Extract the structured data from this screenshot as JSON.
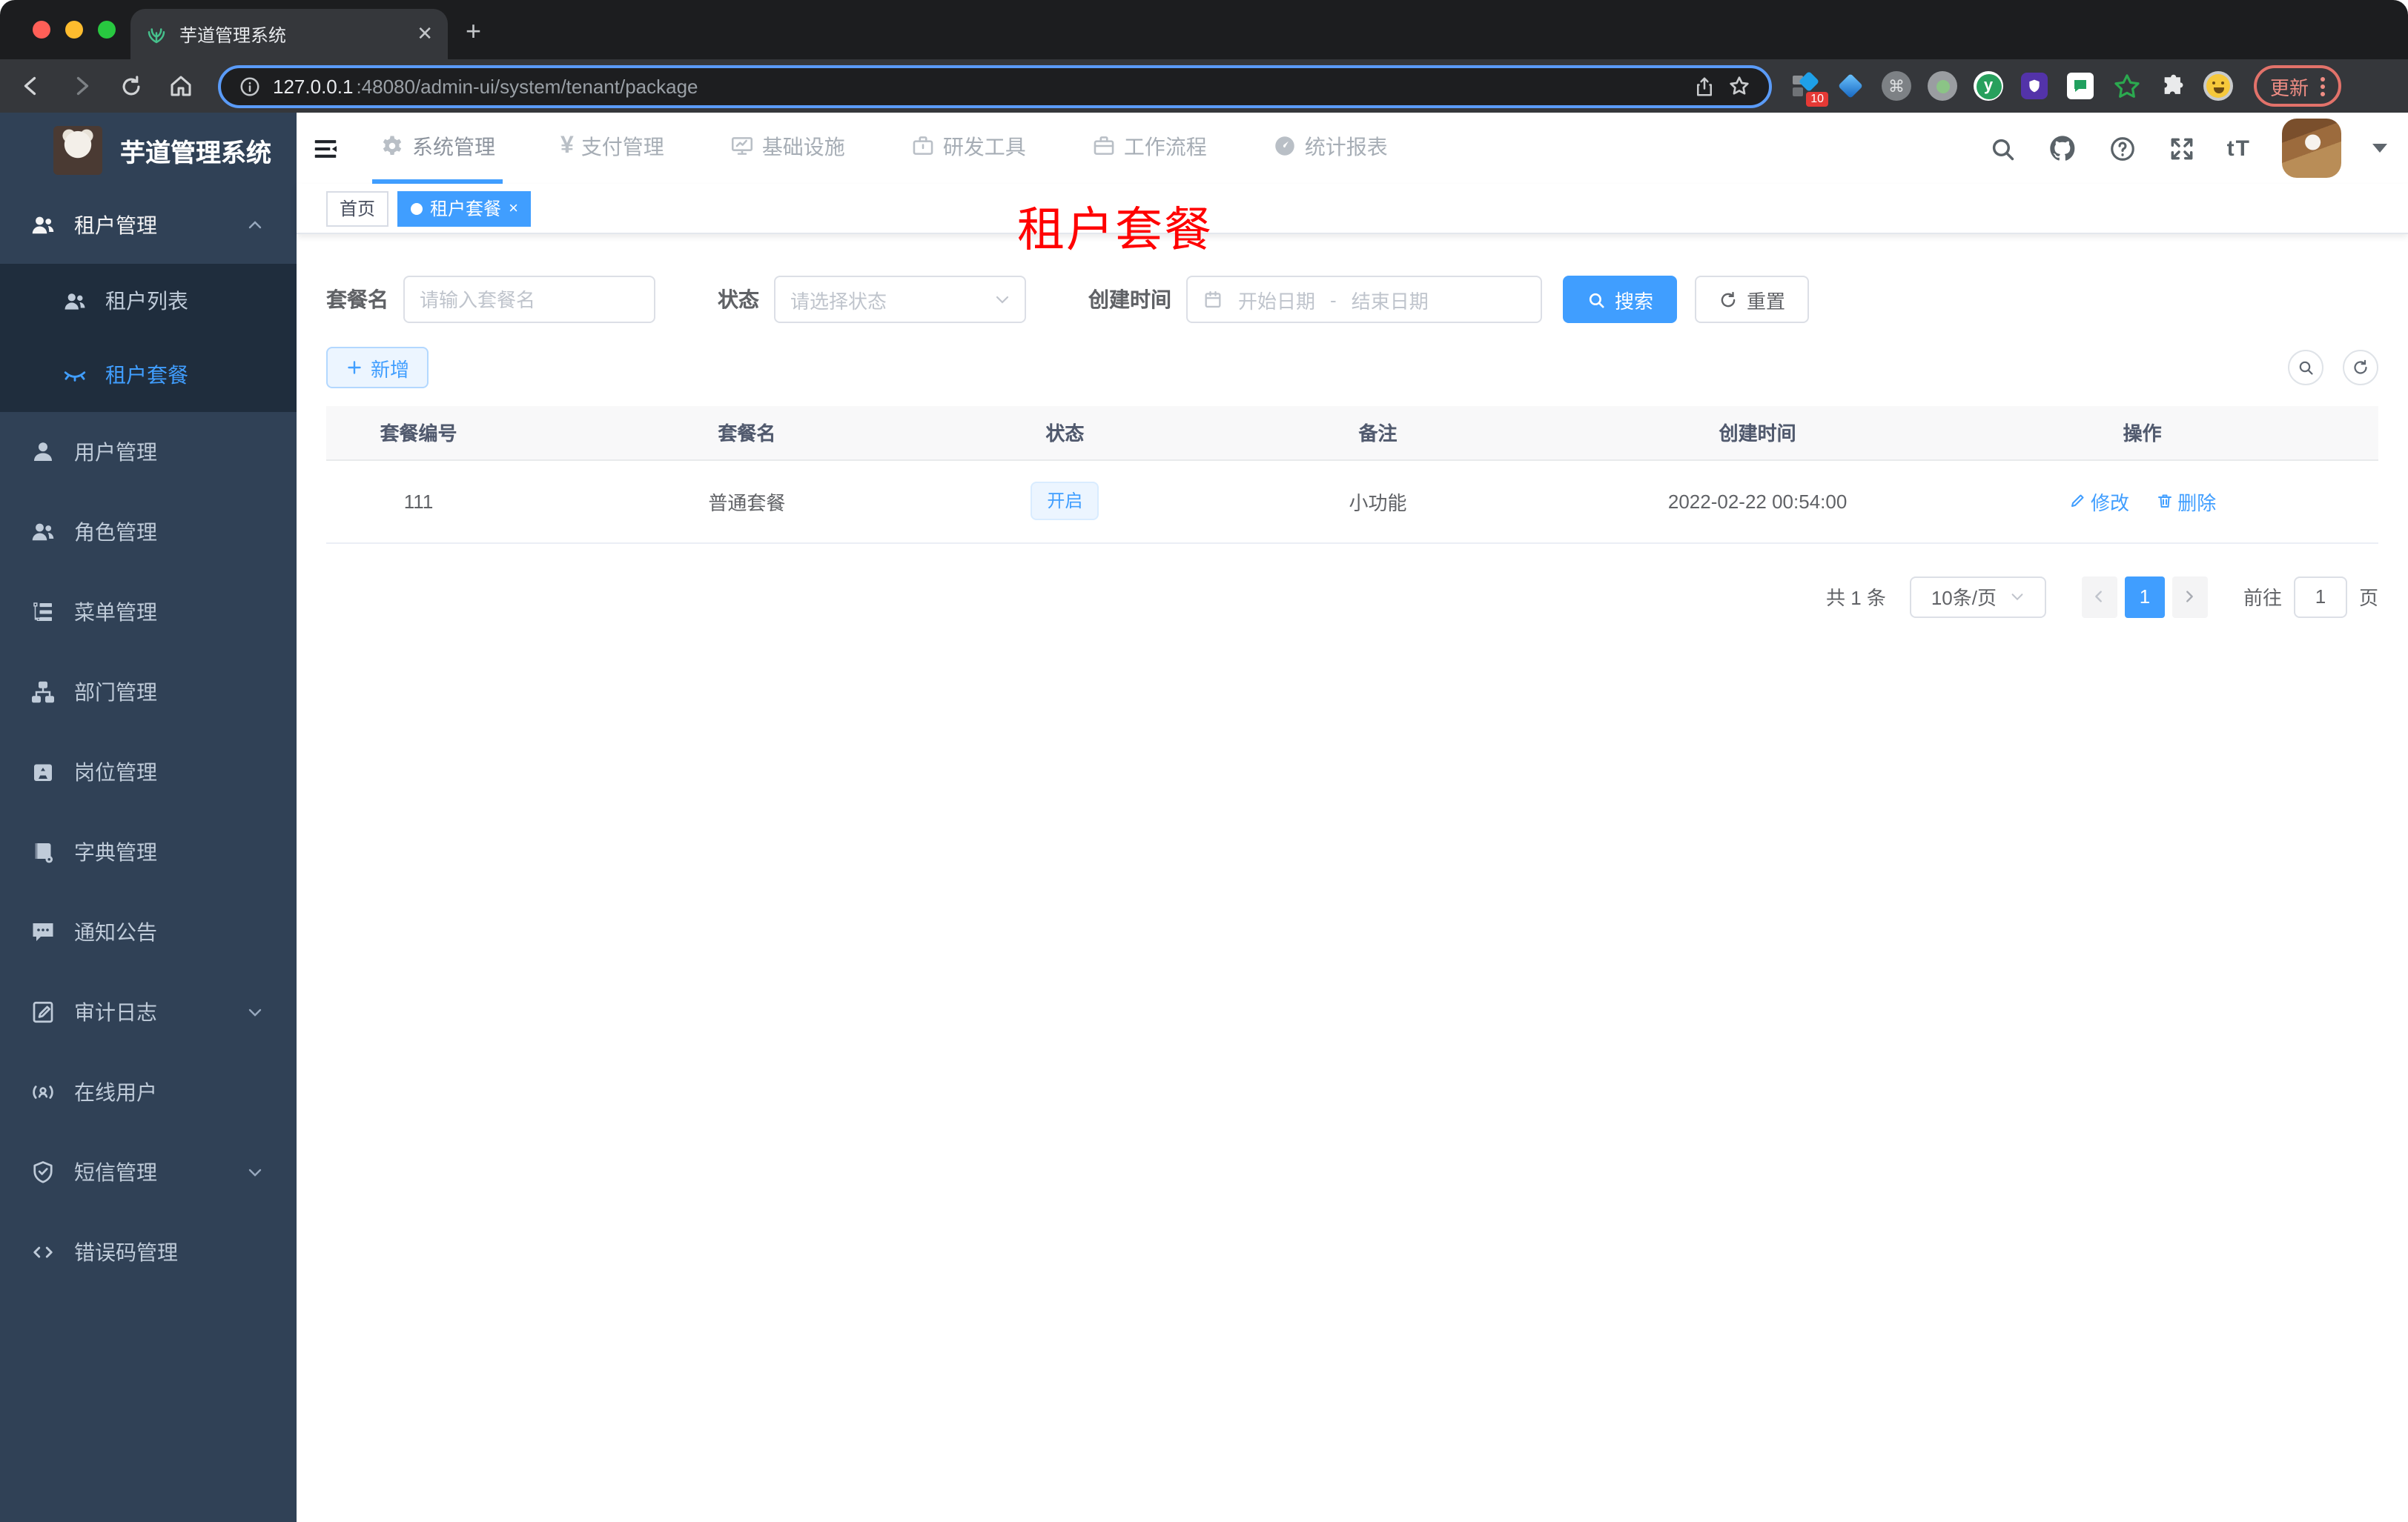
{
  "browser": {
    "tab_title": "芋道管理系统",
    "url_host": "127.0.0.1",
    "url_path": ":48080/admin-ui/system/tenant/package",
    "update_label": "更新",
    "ext_badge": "10"
  },
  "sidebar": {
    "logo_title": "芋道管理系统",
    "items": [
      {
        "label": "租户管理"
      },
      {
        "label": "租户列表"
      },
      {
        "label": "租户套餐"
      },
      {
        "label": "用户管理"
      },
      {
        "label": "角色管理"
      },
      {
        "label": "菜单管理"
      },
      {
        "label": "部门管理"
      },
      {
        "label": "岗位管理"
      },
      {
        "label": "字典管理"
      },
      {
        "label": "通知公告"
      },
      {
        "label": "审计日志"
      },
      {
        "label": "在线用户"
      },
      {
        "label": "短信管理"
      },
      {
        "label": "错误码管理"
      }
    ]
  },
  "nav": {
    "items": [
      {
        "label": "系统管理"
      },
      {
        "label": "支付管理"
      },
      {
        "label": "基础设施"
      },
      {
        "label": "研发工具"
      },
      {
        "label": "工作流程"
      },
      {
        "label": "统计报表"
      }
    ],
    "yen": "¥",
    "font_size_icon": "tT"
  },
  "tags": {
    "home": "首页",
    "active": "租户套餐",
    "close": "×"
  },
  "watermark": "租户套餐",
  "filters": {
    "name_label": "套餐名",
    "name_placeholder": "请输入套餐名",
    "status_label": "状态",
    "status_placeholder": "请选择状态",
    "date_label": "创建时间",
    "date_start": "开始日期",
    "date_sep": "-",
    "date_end": "结束日期",
    "search": "搜索",
    "reset": "重置"
  },
  "toolbar": {
    "add": "新增"
  },
  "table": {
    "headers": [
      "套餐编号",
      "套餐名",
      "状态",
      "备注",
      "创建时间",
      "操作"
    ],
    "rows": [
      {
        "id": "111",
        "name": "普通套餐",
        "status": "开启",
        "remark": "小功能",
        "created": "2022-02-22 00:54:00",
        "edit": "修改",
        "delete": "删除"
      }
    ]
  },
  "pagination": {
    "total": "共 1 条",
    "page_size": "10条/页",
    "page": "1",
    "goto_prefix": "前往",
    "goto_value": "1",
    "goto_suffix": "页"
  },
  "colors": {
    "accent": "#409eff",
    "sidebar_bg": "#304156",
    "submenu_bg": "#1f2d3d",
    "watermark_red": "#ff0000",
    "active_tag": "#409eff"
  }
}
